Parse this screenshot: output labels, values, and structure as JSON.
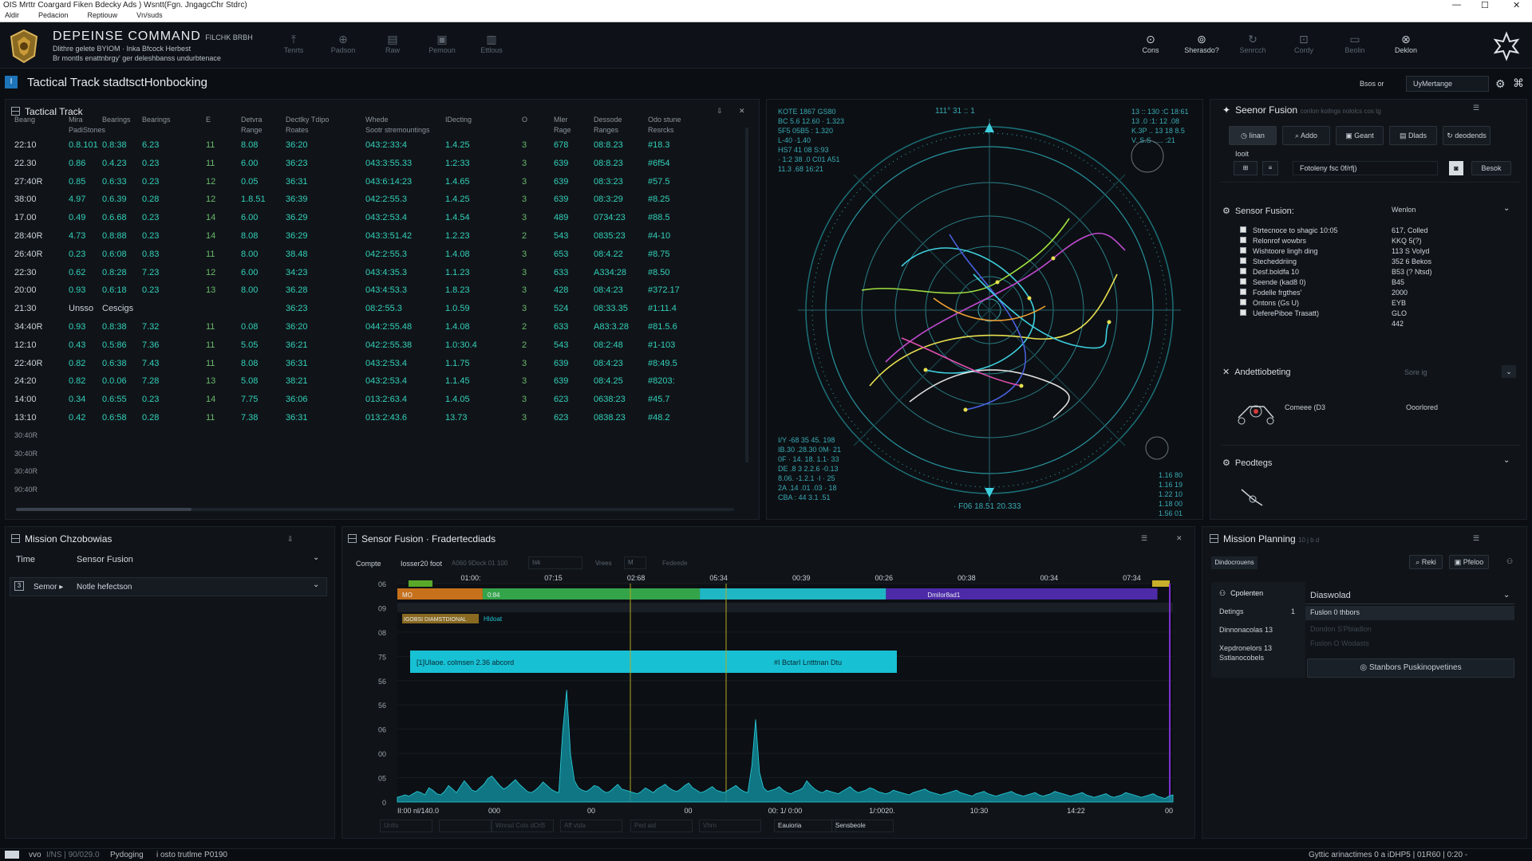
{
  "window": {
    "title": "OIS Mrttr Coargard Fiken Bdecky Ads ) Wsntt(Fgn. JngagcChr Stdrc)"
  },
  "menu": [
    "Aldir",
    "Pedacion",
    "Reptiouw",
    "Vn/suds"
  ],
  "header": {
    "brand_title": "DEPEINSE COMMAND",
    "brand_tag": "FILCHK BRBH",
    "brand_line1": "Dlithre gelete BYIOM · Inka Bfcock Herbest",
    "brand_line2": "Br montls enattnbrgy' ger deleshbanss undurbtenace",
    "toolbar_left": [
      {
        "label": "Tenrts",
        "icon": "up-arrow-icon"
      },
      {
        "label": "Padson",
        "icon": "compass-icon"
      },
      {
        "label": "Raw",
        "icon": "layers-icon"
      },
      {
        "label": "Pemoun",
        "icon": "image-icon"
      },
      {
        "label": "Ettlous",
        "icon": "doc-icon"
      }
    ],
    "toolbar_right": [
      {
        "label": "Cons",
        "icon": "target-icon"
      },
      {
        "label": "Sherasdo?",
        "icon": "radar-icon"
      },
      {
        "label": "Senrcch",
        "icon": "refresh-icon"
      },
      {
        "label": "Cordy",
        "icon": "lock-icon"
      },
      {
        "label": "Beolin",
        "icon": "folder-icon"
      },
      {
        "label": "Deklon",
        "icon": "close-circle-icon"
      }
    ]
  },
  "subheader": {
    "title": "Tactical Track stadtsctHonbocking",
    "right1": "Bsos or",
    "right2": "UyMertange"
  },
  "track": {
    "title": "Tactical Track",
    "headers": [
      [
        "Beang",
        ""
      ],
      [
        "Mira",
        "PadiStones"
      ],
      [
        "",
        "Bearings"
      ],
      [
        "",
        "Bearings"
      ],
      [
        "",
        "E"
      ],
      [
        "Detvra",
        "Range"
      ],
      [
        "Dectlky Tdipo",
        "Roates"
      ],
      [
        "Whede",
        "Sootr stremountings"
      ],
      [
        "",
        "IDecting"
      ],
      [
        "",
        "O"
      ],
      [
        "Mler",
        "Rage"
      ],
      [
        "Dessode",
        "Ranges"
      ],
      [
        "Odo stune",
        "Resrcks"
      ]
    ],
    "rows": [
      [
        "22:10",
        "0.8.101",
        "0.8:38",
        "6.23",
        "11",
        "8.08",
        "36:20",
        "043:2:33:4",
        "1.4.25",
        "3",
        "678",
        "08:8.23",
        "#18.3"
      ],
      [
        "22.30",
        "0.86",
        "0.4.23",
        "0.23",
        "11",
        "6.00",
        "36:23",
        "043:3:55.33",
        "1:2:33",
        "3",
        "639",
        "08:8.23",
        "#6f54"
      ],
      [
        "27:40R",
        "0.85",
        "0.6:33",
        "0.23",
        "12",
        "0.05",
        "36:31",
        "043:6:14:23",
        "1.4.65",
        "3",
        "639",
        "08:3:23",
        "#57.5"
      ],
      [
        "38:00",
        "4.97",
        "0.6.39",
        "0.28",
        "12",
        "1.8.51",
        "36:39",
        "042:2:55.3",
        "1.4.25",
        "3",
        "639",
        "08:3:29",
        "#8.25"
      ],
      [
        "17.00",
        "0.49",
        "0.6.68",
        "0.23",
        "14",
        "6.00",
        "36.29",
        "043:2:53.4",
        "1.4.54",
        "3",
        "489",
        "0734:23",
        "#88.5"
      ],
      [
        "28:40R",
        "4.73",
        "0.8:88",
        "0.23",
        "14",
        "8.08",
        "36:29",
        "043:3:51.42",
        "1.2.23",
        "2",
        "543",
        "0835:23",
        "#4-10"
      ],
      [
        "26:40R",
        "0.23",
        "0.6:08",
        "0.83",
        "11",
        "8.00",
        "38.48",
        "042:2:55.3",
        "1.4.08",
        "3",
        "653",
        "08:4.22",
        "#8.75"
      ],
      [
        "22:30",
        "0.62",
        "0.8:28",
        "7.23",
        "12",
        "6.00",
        "34:23",
        "043:4:35.3",
        "1.1.23",
        "3",
        "633",
        "A334:28",
        "#8.50"
      ],
      [
        "20:00",
        "0.93",
        "0.6:18",
        "0.23",
        "13",
        "8.00",
        "36.28",
        "043:4:53.3",
        "1.8.23",
        "3",
        "428",
        "08:4:23",
        "#372.17"
      ],
      [
        "21:30",
        "Unsso",
        "Cescigs",
        "",
        "",
        "",
        "36:23",
        "08:2:55.3",
        "1.0.59",
        "3",
        "524",
        "08:33.35",
        "#1:11.4"
      ],
      [
        "34:40R",
        "0.93",
        "0.8:38",
        "7.32",
        "11",
        "0.08",
        "36:20",
        "044:2:55.48",
        "1.4.08",
        "2",
        "633",
        "A83:3.28",
        "#81.5.6"
      ],
      [
        "12:10",
        "0.43",
        "0.5:86",
        "7.36",
        "11",
        "5.05",
        "36:21",
        "042:2:55.38",
        "1.0:30.4",
        "2",
        "543",
        "08:2:48",
        "#1-103"
      ],
      [
        "22:40R",
        "0.82",
        "0.6:38",
        "7.43",
        "11",
        "8.08",
        "36:31",
        "043:2:53.4",
        "1.1.75",
        "3",
        "639",
        "08:4:23",
        "#8:49.5"
      ],
      [
        "24:20",
        "0.82",
        "0.0.06",
        "7.28",
        "13",
        "5.08",
        "38:21",
        "043:2:53.4",
        "1.1.45",
        "3",
        "639",
        "08:4.25",
        "#8203:"
      ],
      [
        "14:00",
        "0.34",
        "0.6:55",
        "0.23",
        "14",
        "7.75",
        "36:06",
        "013:2:63.4",
        "1.4.05",
        "3",
        "623",
        "0638:23",
        "#45.7"
      ],
      [
        "13:10",
        "0.42",
        "0.6:58",
        "0.28",
        "11",
        "7.38",
        "36:31",
        "013:2:43.6",
        "13.73",
        "3",
        "623",
        "0838.23",
        "#48.2"
      ]
    ],
    "empty_rows": [
      "30:40R",
      "30:40R",
      "30:40R",
      "90:40R"
    ]
  },
  "radar": {
    "top_left": [
      "KOTE 1867 GS80",
      "BC 5.6 12.60 · 1.323",
      "5F5 05B5 : 1.320",
      "L-40 ·1.40",
      "HS7 41 08 S:93",
      "· 1:2 38 .0 C01 A51",
      "11.3 .68 16:21"
    ],
    "top_center": "111° 31 :: 1",
    "top_right": [
      "13 :: 130 :C 18:61",
      "13 .0 :1: 12 .08",
      "K.3P .. 13 18 8.5",
      "V. S.S .....  :21"
    ],
    "bottom_left": [
      "I/Y -68 35 45. 198",
      "IB.30 .28.30 0M· 21",
      "0F · 14. 18. 1.1· 33",
      "DE .8 3 2.2.6 -0.13",
      "8.06. -1.2.1 ·I  · 25",
      "2A .14 .01 .03 · 18",
      "CBA : 44 3.1 .51"
    ],
    "bottom_center": "· F06 18.51 20.333",
    "bottom_right": [
      "1.16 80",
      "1.16 19",
      "1.22 10",
      "1.18 00",
      "1.56 01"
    ],
    "compass_west": "◂▸",
    "compass_east": "◂▸"
  },
  "sensor_panel": {
    "title": "Seenor Fusion",
    "title_sub": "conlon koilngs nololcs cos tg",
    "tabs": [
      {
        "label": "Iinan",
        "icon": "clock-icon"
      },
      {
        "label": "Addo",
        "icon": "search-icon"
      },
      {
        "label": "Geant",
        "icon": "grid-icon"
      },
      {
        "label": "Dlads",
        "icon": "table-icon"
      },
      {
        "label": "deodends",
        "icon": "refresh-icon"
      }
    ],
    "field_label": "Iooit",
    "field_value": "Fotoleny fsc 0f/rfj)",
    "field_btn": "Besok",
    "fusion_title": "Sensor Fusion:",
    "fusion_right": "Wenlon",
    "checklist": [
      [
        "Strtecnoce to shagic 10:05",
        "617, Colled"
      ],
      [
        "Relonrof wowbrs",
        "KKQ 5(?)"
      ],
      [
        "Wishtoore lingh ding",
        "113 S Volyd"
      ],
      [
        "Stecheddriing",
        "352 6 Bekos"
      ],
      [
        "Desf.boldfa 10",
        "B53 (? Ntsd)"
      ],
      [
        "Seende (kad8 0)",
        "B45"
      ],
      [
        "Fodelle frgthes'",
        "2000"
      ],
      [
        "Ontons (Gs U)",
        "EYB"
      ],
      [
        "UeferePiboe Trasatt)",
        "GLO"
      ],
      [
        "",
        "442"
      ]
    ],
    "anti_title": "Andettiobeting",
    "anti_right": "Sore ig",
    "anti_item": "Comeee (D3",
    "anti_value": "Ooorlored",
    "peo_title": "Peodtegs"
  },
  "mission_left": {
    "title": "Mission Chzobowias",
    "col1": "Time",
    "col2": "Sensor Fusion",
    "row_left": "Semor",
    "row_right": "Notle hefectson"
  },
  "timeline": {
    "title": "Sensor Fusion · Fradertecdiads",
    "ctrl_label": "Compte",
    "ctrl_value": "Iosser20 foot",
    "ctrl_b": "A060 9Dock 01 100",
    "ctrl_c": "Isk",
    "ctrl_d": "Vrees",
    "ctrl_e": "M",
    "ctrl_f": "Fedeede",
    "ticks": [
      "01:00:",
      "07:15",
      "02:68",
      "05:34",
      "00:39",
      "00:26",
      "00:38",
      "00:34",
      "07:34"
    ],
    "y_labels": [
      "06",
      "09",
      "08",
      "75",
      "56",
      "56",
      "06",
      "00",
      "05",
      "0"
    ],
    "bar_labels": [
      "MO",
      "0:84",
      "",
      "Dmilor8ad1"
    ],
    "track2": "IGOBSI DIAMSTDIONAL",
    "track2b": "Hldoat",
    "event_label": "[1]Ulaoe. colmsen 2.36 abcord",
    "event_right": "#I BctarI Lntttnan Dtu",
    "x_labels": [
      "II:00 nl/140.0",
      "000",
      "00",
      "00",
      "00: 1/ 0:00",
      "1/:0020.",
      "10:30",
      "14:22",
      "00"
    ],
    "footer": [
      "Unlts",
      "",
      "Wnrsd Cols dOrB",
      "Aff vtda",
      "Ped aid",
      "Vhrn",
      "Eauioria",
      "Sensbeole"
    ],
    "spectrum": [
      4,
      5,
      6,
      5,
      7,
      9,
      8,
      6,
      12,
      10,
      7,
      6,
      9,
      14,
      11,
      8,
      13,
      18,
      14,
      10,
      9,
      12,
      15,
      20,
      22,
      18,
      14,
      11,
      13,
      16,
      19,
      15,
      12,
      9,
      8,
      10,
      13,
      17,
      14,
      11,
      9,
      8,
      60,
      95,
      40,
      18,
      12,
      10,
      9,
      11,
      14,
      13,
      10,
      8,
      9,
      12,
      15,
      11,
      10,
      9,
      8,
      7,
      9,
      12,
      10,
      8,
      11,
      13,
      15,
      12,
      10,
      9,
      11,
      14,
      16,
      12,
      10,
      8,
      9,
      11,
      13,
      10,
      9,
      8,
      10,
      12,
      14,
      11,
      9,
      8,
      30,
      70,
      25,
      12,
      9,
      10,
      11,
      13,
      10,
      8,
      7,
      9,
      10,
      12,
      18,
      14,
      11,
      9,
      8,
      10,
      9,
      8,
      7,
      9,
      11,
      13,
      10,
      8,
      9,
      10,
      12,
      11,
      9,
      8,
      7,
      8,
      10,
      9,
      8,
      7,
      6,
      8,
      9,
      10,
      11,
      9,
      8,
      7,
      6,
      7,
      8,
      9,
      10,
      8,
      7,
      6,
      5,
      7,
      8,
      9,
      7,
      6,
      5,
      6,
      7,
      8,
      9,
      7,
      6,
      5,
      6,
      7,
      8,
      6,
      5,
      6,
      7,
      9,
      8,
      7,
      6,
      5,
      6,
      7,
      8,
      6,
      5,
      4,
      5,
      6,
      7,
      5,
      4,
      5,
      6,
      8,
      7,
      6,
      5,
      4,
      5,
      6,
      7,
      5,
      4,
      3,
      5,
      6
    ]
  },
  "mission_right": {
    "title": "Mission Planning",
    "title_sub": "10 j b d",
    "chip": "Dindocrouens",
    "btn_a": "Reki",
    "btn_b": "Pfeloo",
    "list": [
      "Cpolenten",
      "Detings",
      "Dinnonacolas 13",
      "Xepdronelors 13 Sstlanocobels"
    ],
    "list_badge": "1",
    "select_label": "Diaswolad",
    "sel_item1": "Fuslon 0 thbors",
    "sel_item2": "Dondon S'Pbiadlon",
    "sel_item3": "Fuslon O Wodasts",
    "action": "Stanbors Puskinopvetines"
  },
  "status": {
    "left1": "vvo",
    "left2": "I/NS | 90/029.0",
    "left3": "Pydoging",
    "left4": "i osto trutlme P0190",
    "right": "Gyttic arinactimes 0 a iDHP5 | 01R60 | 0:20 -"
  },
  "colors": {
    "accent": "#33d0b8",
    "bg": "#0b0e13",
    "panel": "#101419",
    "cyan": "#20c2cf",
    "green": "#34a44a",
    "purple": "#4c2aa8",
    "orange": "#c7711c"
  }
}
